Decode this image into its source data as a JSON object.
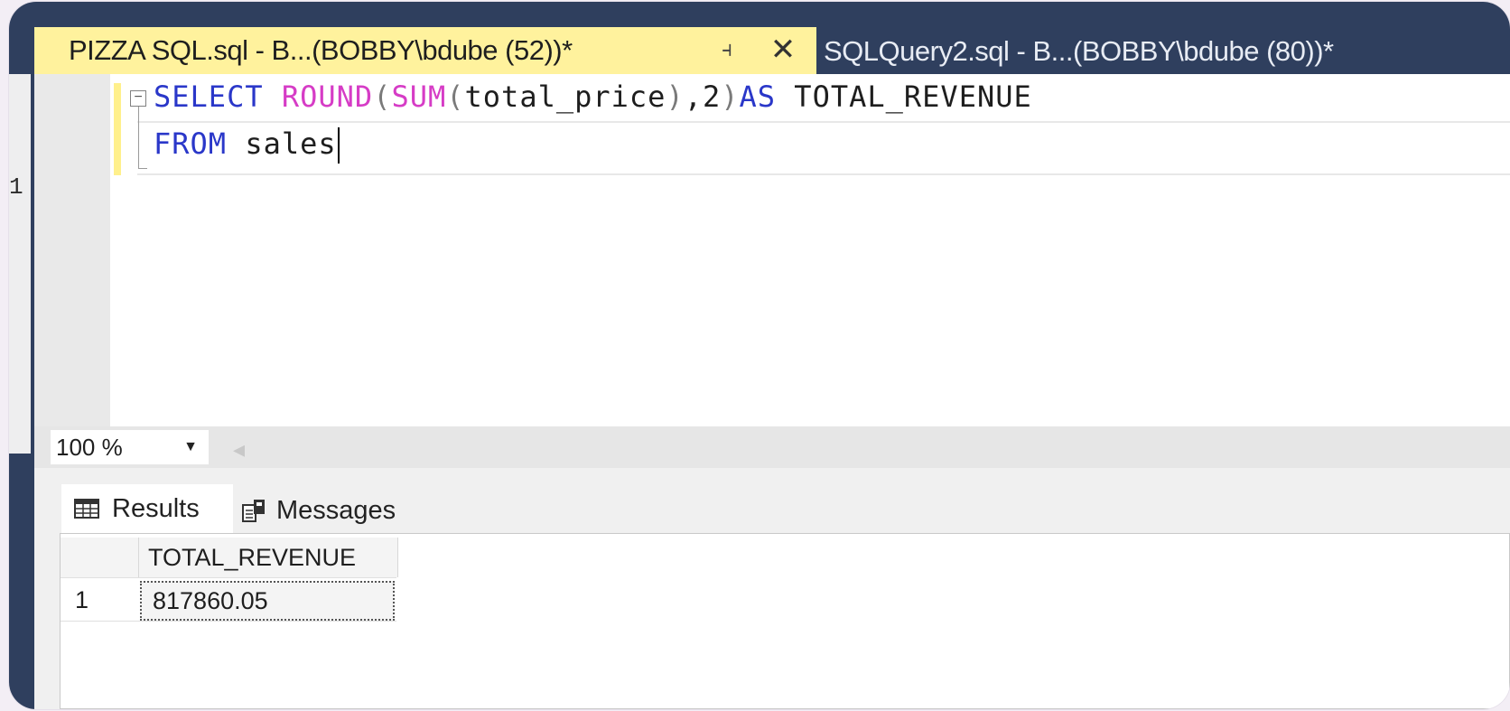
{
  "tabs": {
    "active": {
      "title": "PIZZA SQL.sql - B...(BOBBY\\bdube (52))*"
    },
    "inactive": {
      "title": "SQLQuery2.sql - B...(BOBBY\\bdube (80))*"
    }
  },
  "left_gutter": {
    "line_number": "1"
  },
  "editor": {
    "line1": {
      "select": "SELECT",
      "round": "ROUND",
      "open1": "(",
      "sum": "SUM",
      "open2": "(",
      "arg": "total_price",
      "close2": ")",
      "comma_two": ",2",
      "close1": ")",
      "as": "AS",
      "alias": " TOTAL_REVENUE"
    },
    "line2": {
      "from": "FROM",
      "table": " sales"
    }
  },
  "zoom": {
    "value": "100 %"
  },
  "results_tabs": {
    "results": "Results",
    "messages": "Messages"
  },
  "grid": {
    "columns": [
      "TOTAL_REVENUE"
    ],
    "rows": [
      {
        "num": "1",
        "cells": [
          "817860.05"
        ]
      }
    ]
  },
  "icons": {
    "pin": "pin-icon",
    "close": "close-icon",
    "collapse": "collapse-icon",
    "dropdown": "chevron-down-icon",
    "results": "grid-icon",
    "messages": "messages-icon"
  }
}
